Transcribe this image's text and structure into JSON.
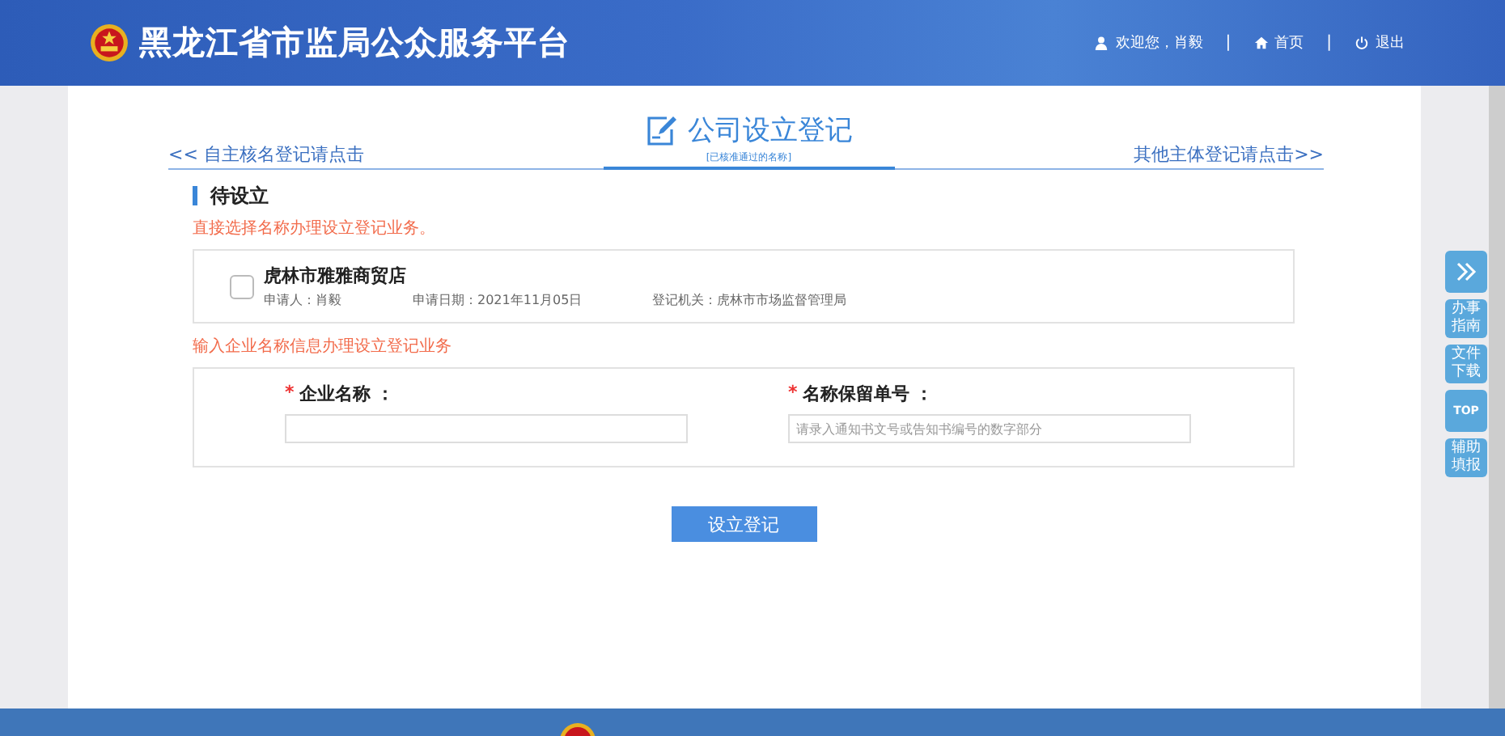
{
  "header": {
    "title": "黑龙江省市监局公众服务平台",
    "nav": [
      {
        "kind": "user",
        "label": "欢迎您，肖毅"
      },
      {
        "kind": "home",
        "label": "首页"
      },
      {
        "kind": "power",
        "label": "退出"
      }
    ],
    "separator": "|"
  },
  "page": {
    "title": "公司设立登记",
    "subtitle": "[已核准通过的名称]",
    "left_link": "<< 自主核名登记请点击",
    "right_link": "其他主体登记请点击>>"
  },
  "section": {
    "title": "待设立",
    "hint": "直接选择名称办理设立登记业务。",
    "candidates": [
      {
        "name": "虎林市雅雅商贸店",
        "applicant": "申请人：肖毅",
        "date": "申请日期：2021年11月05日",
        "authority": "登记机关：虎林市市场监督管理局",
        "checked": false
      }
    ],
    "form_hint": "输入企业名称信息办理设立登记业务",
    "fields": [
      {
        "label": "企业名称 ：",
        "required_mark": "*"
      },
      {
        "label": "名称保留单号 ：",
        "required_mark": "*",
        "placeholder": "请录入通知书文号或告知书编号的数字部分"
      }
    ],
    "submit": "设立登记"
  },
  "side_buttons": [
    {
      "kind": "icon"
    },
    {
      "kind": "text",
      "label": "办事指南"
    },
    {
      "kind": "text",
      "label": "文件下载"
    },
    {
      "kind": "top",
      "label": "TOP"
    },
    {
      "kind": "text",
      "label": "辅助填报"
    }
  ]
}
